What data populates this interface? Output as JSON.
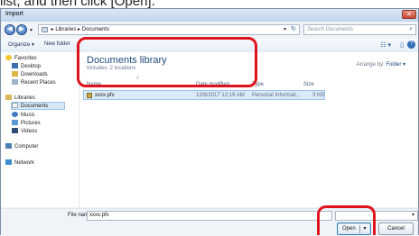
{
  "caption_text": "list, and then click [Open].",
  "window": {
    "title": "Import",
    "close_glyph": "✕"
  },
  "nav": {
    "back_glyph": "◀",
    "forward_glyph": "▶",
    "dropdown_glyph": "▾",
    "path_sep": "▸",
    "path": [
      "Libraries",
      "Documents"
    ],
    "refresh_glyph": "↻",
    "search_placeholder": "Search Documents",
    "search_glyph": "⌕"
  },
  "toolbar": {
    "organize": "Organize ▾",
    "new_folder": "New folder",
    "views_glyph": "☷ ▾",
    "pane_glyph": "▯",
    "help_glyph": "?"
  },
  "sidebar": {
    "favorites": "Favorites",
    "desktop": "Desktop",
    "downloads": "Downloads",
    "recent": "Recent Places",
    "libraries": "Libraries",
    "documents": "Documents",
    "music": "Music",
    "pictures": "Pictures",
    "videos": "Videos",
    "computer": "Computer",
    "network": "Network"
  },
  "library": {
    "title": "Documents library",
    "subtitle": "Includes: 2 locations",
    "arrange_label": "Arrange by:",
    "arrange_value": "Folder ▾"
  },
  "columns": {
    "name": "Name",
    "date": "Date modified",
    "type": "Type",
    "size": "Size",
    "sort_glyph": "˄"
  },
  "file": {
    "name": "xxxx.pfx",
    "date": "12/6/2017 12:19 AM",
    "type": "Personal Informati...",
    "size": "3 KB"
  },
  "bottom": {
    "file_name_label": "File name:",
    "file_name_value": "xxxx.pfx",
    "combo_arrow": "▾",
    "open_label": "Open",
    "open_drop": "▾",
    "cancel_label": "Cancel"
  },
  "colors": {
    "highlight": "#e0131d",
    "accent": "#1f4a7f"
  }
}
